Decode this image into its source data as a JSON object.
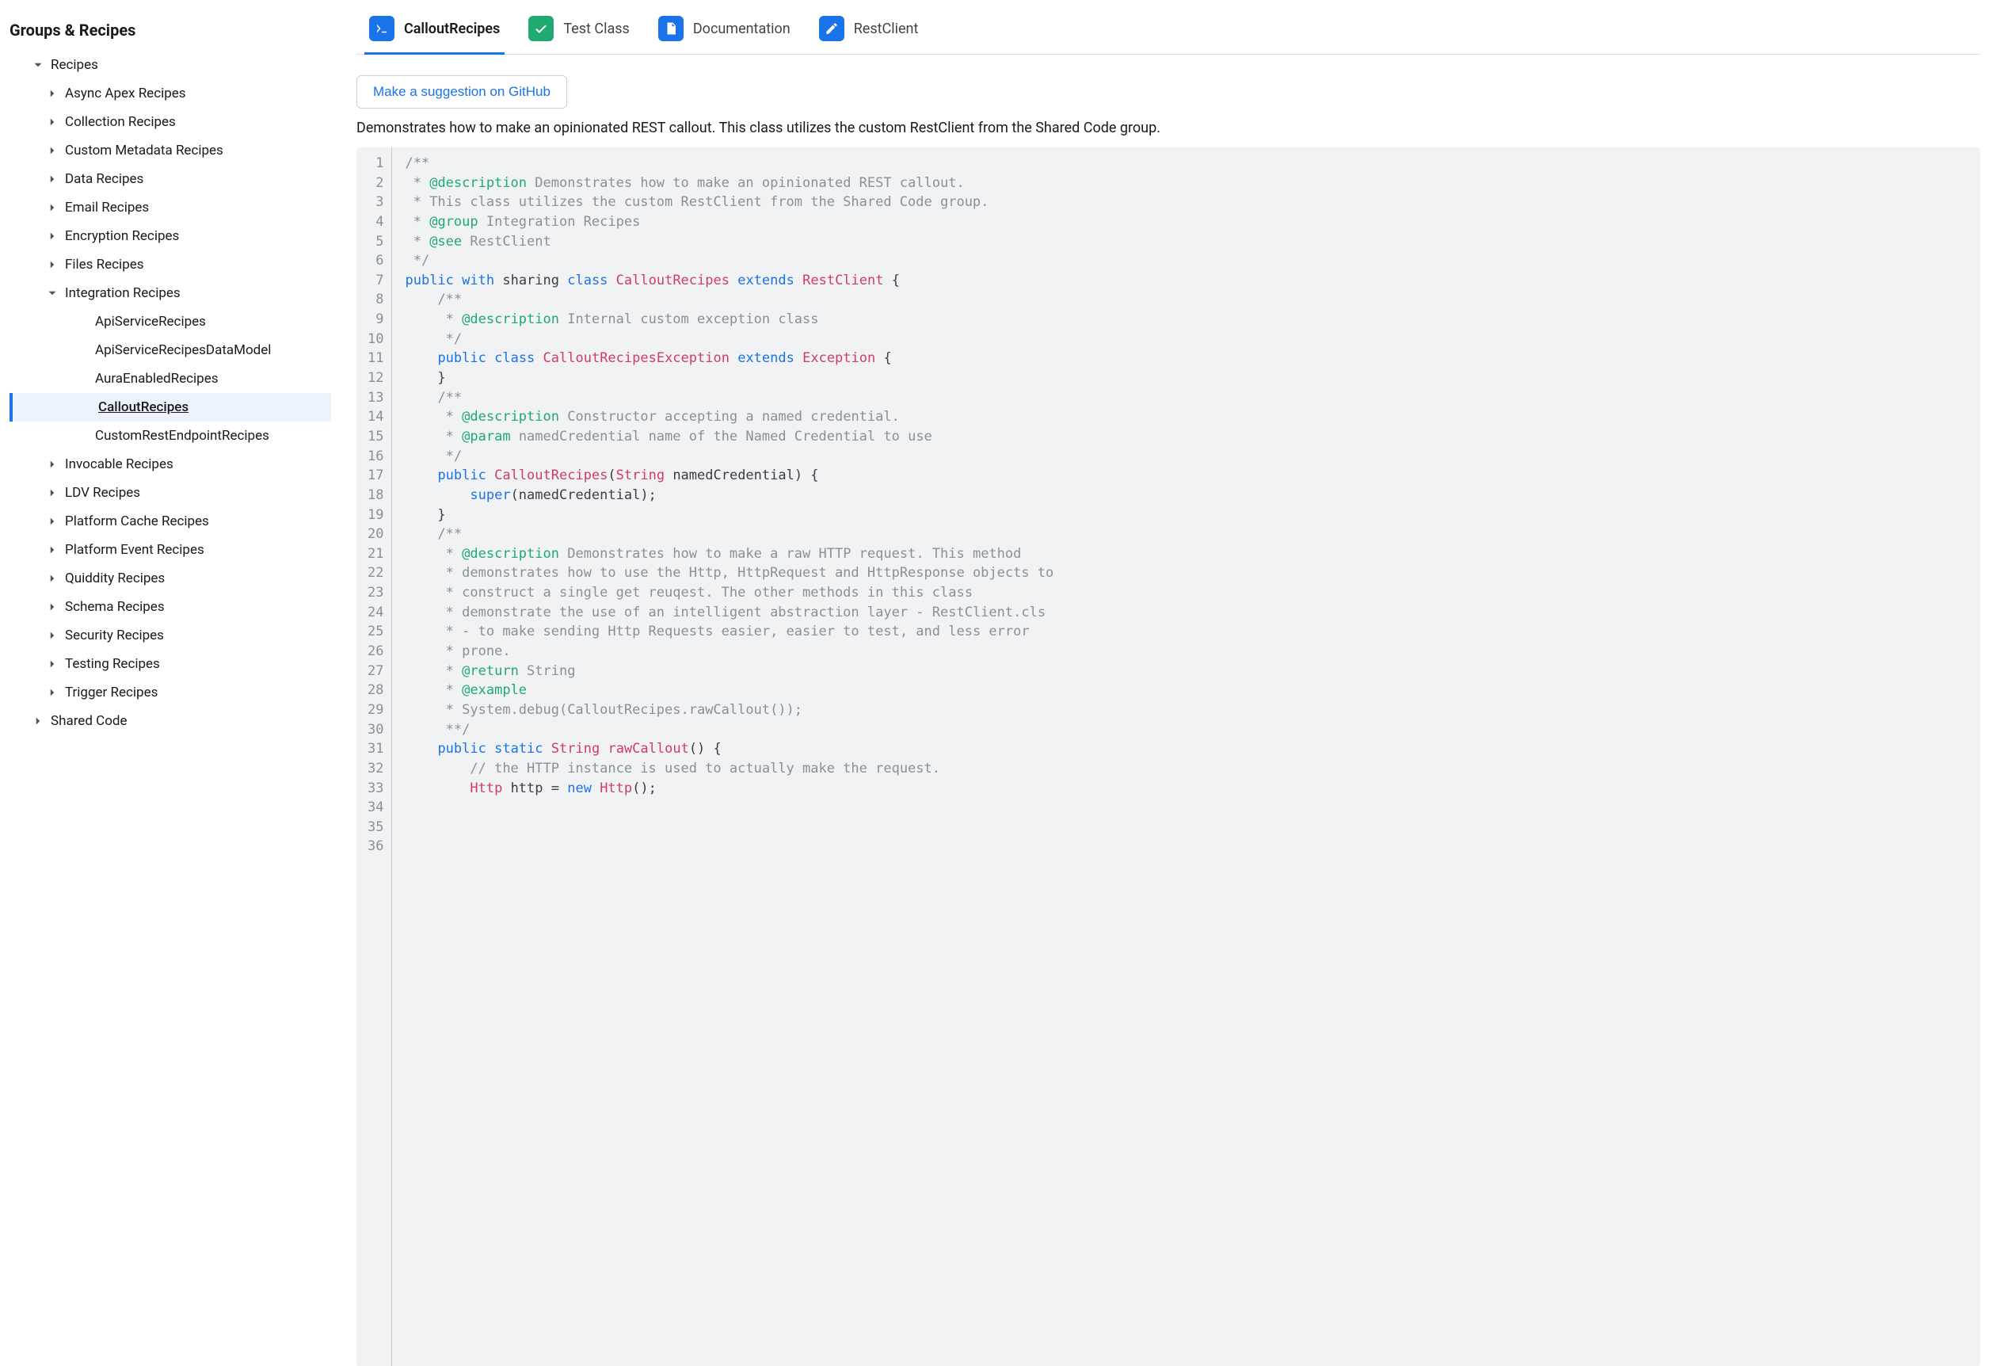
{
  "sidebar": {
    "title": "Groups & Recipes",
    "items": [
      {
        "label": "Recipes",
        "level": 0,
        "expanded": true,
        "interact": true
      },
      {
        "label": "Async Apex Recipes",
        "level": 1,
        "expanded": false,
        "interact": true
      },
      {
        "label": "Collection Recipes",
        "level": 1,
        "expanded": false,
        "interact": true
      },
      {
        "label": "Custom Metadata Recipes",
        "level": 1,
        "expanded": false,
        "interact": true
      },
      {
        "label": "Data Recipes",
        "level": 1,
        "expanded": false,
        "interact": true
      },
      {
        "label": "Email Recipes",
        "level": 1,
        "expanded": false,
        "interact": true
      },
      {
        "label": "Encryption Recipes",
        "level": 1,
        "expanded": false,
        "interact": true
      },
      {
        "label": "Files Recipes",
        "level": 1,
        "expanded": false,
        "interact": true
      },
      {
        "label": "Integration Recipes",
        "level": 1,
        "expanded": true,
        "interact": true
      },
      {
        "label": "ApiServiceRecipes",
        "level": 2,
        "leaf": true,
        "interact": true
      },
      {
        "label": "ApiServiceRecipesDataModel",
        "level": 2,
        "leaf": true,
        "interact": true
      },
      {
        "label": "AuraEnabledRecipes",
        "level": 2,
        "leaf": true,
        "interact": true
      },
      {
        "label": "CalloutRecipes",
        "level": 2,
        "leaf": true,
        "selected": true,
        "interact": true
      },
      {
        "label": "CustomRestEndpointRecipes",
        "level": 2,
        "leaf": true,
        "interact": true
      },
      {
        "label": "Invocable Recipes",
        "level": 1,
        "expanded": false,
        "interact": true
      },
      {
        "label": "LDV Recipes",
        "level": 1,
        "expanded": false,
        "interact": true
      },
      {
        "label": "Platform Cache Recipes",
        "level": 1,
        "expanded": false,
        "interact": true
      },
      {
        "label": "Platform Event Recipes",
        "level": 1,
        "expanded": false,
        "interact": true
      },
      {
        "label": "Quiddity Recipes",
        "level": 1,
        "expanded": false,
        "interact": true
      },
      {
        "label": "Schema Recipes",
        "level": 1,
        "expanded": false,
        "interact": true
      },
      {
        "label": "Security Recipes",
        "level": 1,
        "expanded": false,
        "interact": true
      },
      {
        "label": "Testing Recipes",
        "level": 1,
        "expanded": false,
        "interact": true
      },
      {
        "label": "Trigger Recipes",
        "level": 1,
        "expanded": false,
        "interact": true
      },
      {
        "label": "Shared Code",
        "level": 0,
        "expanded": false,
        "interact": true
      }
    ]
  },
  "tabs": [
    {
      "label": "CalloutRecipes",
      "icon": "terminal",
      "color": "blue",
      "active": true
    },
    {
      "label": "Test Class",
      "icon": "check",
      "color": "green",
      "active": false
    },
    {
      "label": "Documentation",
      "icon": "doc",
      "color": "bluedoc",
      "active": false
    },
    {
      "label": "RestClient",
      "icon": "edit",
      "color": "blue",
      "active": false
    }
  ],
  "main": {
    "suggest_label": "Make a suggestion on GitHub",
    "description": "Demonstrates how to make an opinionated REST callout. This class utilizes the custom RestClient from the Shared Code group."
  },
  "code": {
    "total_lines": 36,
    "lines": [
      [
        [
          "cmt",
          "/**"
        ]
      ],
      [
        [
          "cmt",
          " * "
        ],
        [
          "tag",
          "@description"
        ],
        [
          "cmt",
          " Demonstrates how to make an opinionated REST callout."
        ]
      ],
      [
        [
          "cmt",
          " * This class utilizes the custom RestClient from the Shared Code group."
        ]
      ],
      [
        [
          "cmt",
          " * "
        ],
        [
          "tag",
          "@group"
        ],
        [
          "cmt",
          " Integration Recipes"
        ]
      ],
      [
        [
          "cmt",
          " * "
        ],
        [
          "tag",
          "@see"
        ],
        [
          "cmt",
          " RestClient"
        ]
      ],
      [
        [
          "cmt",
          " */"
        ]
      ],
      [
        [
          "kw",
          "public"
        ],
        [
          "plain",
          " "
        ],
        [
          "kw",
          "with"
        ],
        [
          "plain",
          " sharing "
        ],
        [
          "kw",
          "class"
        ],
        [
          "plain",
          " "
        ],
        [
          "cls",
          "CalloutRecipes"
        ],
        [
          "plain",
          " "
        ],
        [
          "kw",
          "extends"
        ],
        [
          "plain",
          " "
        ],
        [
          "cls",
          "RestClient"
        ],
        [
          "plain",
          " {"
        ]
      ],
      [
        [
          "plain",
          "    "
        ],
        [
          "cmt",
          "/**"
        ]
      ],
      [
        [
          "plain",
          "    "
        ],
        [
          "cmt",
          " * "
        ],
        [
          "tag",
          "@description"
        ],
        [
          "cmt",
          " Internal custom exception class"
        ]
      ],
      [
        [
          "plain",
          "    "
        ],
        [
          "cmt",
          " */"
        ]
      ],
      [
        [
          "plain",
          "    "
        ],
        [
          "kw",
          "public"
        ],
        [
          "plain",
          " "
        ],
        [
          "kw",
          "class"
        ],
        [
          "plain",
          " "
        ],
        [
          "cls",
          "CalloutRecipesException"
        ],
        [
          "plain",
          " "
        ],
        [
          "kw",
          "extends"
        ],
        [
          "plain",
          " "
        ],
        [
          "cls",
          "Exception"
        ],
        [
          "plain",
          " {"
        ]
      ],
      [
        [
          "plain",
          "    }"
        ]
      ],
      [
        [
          "plain",
          ""
        ]
      ],
      [
        [
          "plain",
          "    "
        ],
        [
          "cmt",
          "/**"
        ]
      ],
      [
        [
          "plain",
          "    "
        ],
        [
          "cmt",
          " * "
        ],
        [
          "tag",
          "@description"
        ],
        [
          "cmt",
          " Constructor accepting a named credential."
        ]
      ],
      [
        [
          "plain",
          "    "
        ],
        [
          "cmt",
          " * "
        ],
        [
          "tag",
          "@param"
        ],
        [
          "cmt",
          " namedCredential name of the Named Credential to use"
        ]
      ],
      [
        [
          "plain",
          "    "
        ],
        [
          "cmt",
          " */"
        ]
      ],
      [
        [
          "plain",
          "    "
        ],
        [
          "kw",
          "public"
        ],
        [
          "plain",
          " "
        ],
        [
          "cls",
          "CalloutRecipes"
        ],
        [
          "plain",
          "("
        ],
        [
          "cls",
          "String"
        ],
        [
          "plain",
          " namedCredential) {"
        ]
      ],
      [
        [
          "plain",
          "        "
        ],
        [
          "kw",
          "super"
        ],
        [
          "plain",
          "(namedCredential);"
        ]
      ],
      [
        [
          "plain",
          "    }"
        ]
      ],
      [
        [
          "plain",
          ""
        ]
      ],
      [
        [
          "plain",
          "    "
        ],
        [
          "cmt",
          "/**"
        ]
      ],
      [
        [
          "plain",
          "    "
        ],
        [
          "cmt",
          " * "
        ],
        [
          "tag",
          "@description"
        ],
        [
          "cmt",
          " Demonstrates how to make a raw HTTP request. This method"
        ]
      ],
      [
        [
          "plain",
          "    "
        ],
        [
          "cmt",
          " * demonstrates how to use the Http, HttpRequest and HttpResponse objects to"
        ]
      ],
      [
        [
          "plain",
          "    "
        ],
        [
          "cmt",
          " * construct a single get reuqest. The other methods in this class"
        ]
      ],
      [
        [
          "plain",
          "    "
        ],
        [
          "cmt",
          " * demonstrate the use of an intelligent abstraction layer - RestClient.cls"
        ]
      ],
      [
        [
          "plain",
          "    "
        ],
        [
          "cmt",
          " * - to make sending Http Requests easier, easier to test, and less error"
        ]
      ],
      [
        [
          "plain",
          "    "
        ],
        [
          "cmt",
          " * prone."
        ]
      ],
      [
        [
          "plain",
          "    "
        ],
        [
          "cmt",
          " * "
        ],
        [
          "tag",
          "@return"
        ],
        [
          "cmt",
          " String"
        ]
      ],
      [
        [
          "plain",
          "    "
        ],
        [
          "cmt",
          " * "
        ],
        [
          "tag",
          "@example"
        ]
      ],
      [
        [
          "plain",
          "    "
        ],
        [
          "cmt",
          " * System.debug(CalloutRecipes.rawCallout());"
        ]
      ],
      [
        [
          "plain",
          "    "
        ],
        [
          "cmt",
          " **/"
        ]
      ],
      [
        [
          "plain",
          "    "
        ],
        [
          "kw",
          "public"
        ],
        [
          "plain",
          " "
        ],
        [
          "kw",
          "static"
        ],
        [
          "plain",
          " "
        ],
        [
          "cls",
          "String"
        ],
        [
          "plain",
          " "
        ],
        [
          "fn",
          "rawCallout"
        ],
        [
          "plain",
          "() {"
        ]
      ],
      [
        [
          "plain",
          "        "
        ],
        [
          "cmt",
          "// the HTTP instance is used to actually make the request."
        ]
      ],
      [
        [
          "plain",
          "        "
        ],
        [
          "cls",
          "Http"
        ],
        [
          "plain",
          " http = "
        ],
        [
          "kw",
          "new"
        ],
        [
          "plain",
          " "
        ],
        [
          "cls",
          "Http"
        ],
        [
          "plain",
          "();"
        ]
      ]
    ]
  }
}
